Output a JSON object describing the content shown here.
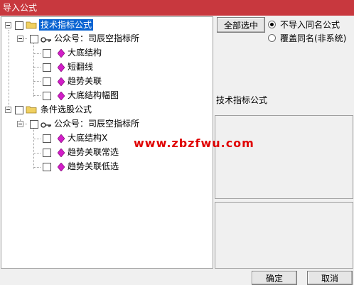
{
  "window": {
    "title": "导入公式"
  },
  "tree": {
    "groups": [
      {
        "label": "技术指标公式",
        "selected": true,
        "publisher": "公众号：司辰空指标所",
        "items": [
          "大底结构",
          "短翻线",
          "趋势关联",
          "大底结构幅图"
        ]
      },
      {
        "label": "条件选股公式",
        "selected": false,
        "publisher": "公众号：司辰空指标所",
        "items": [
          "大底结构X",
          "趋势关联常选",
          "趋势关联低选"
        ]
      }
    ]
  },
  "options": {
    "select_all_label": "全部选中",
    "radio_options": [
      {
        "label": "不导入同名公式",
        "checked": true
      },
      {
        "label": "覆盖同名(非系统)",
        "checked": false
      }
    ]
  },
  "info": {
    "label": "技术指标公式"
  },
  "watermark": {
    "text": "www.zbzfwu.com"
  },
  "footer": {
    "ok_label": "确定",
    "cancel_label": "取消"
  },
  "colors": {
    "titlebar": "#c8383e",
    "selection": "#0a64d2",
    "watermark": "#e00000",
    "gem": "#d21ec8",
    "folder": "#f0d060"
  }
}
